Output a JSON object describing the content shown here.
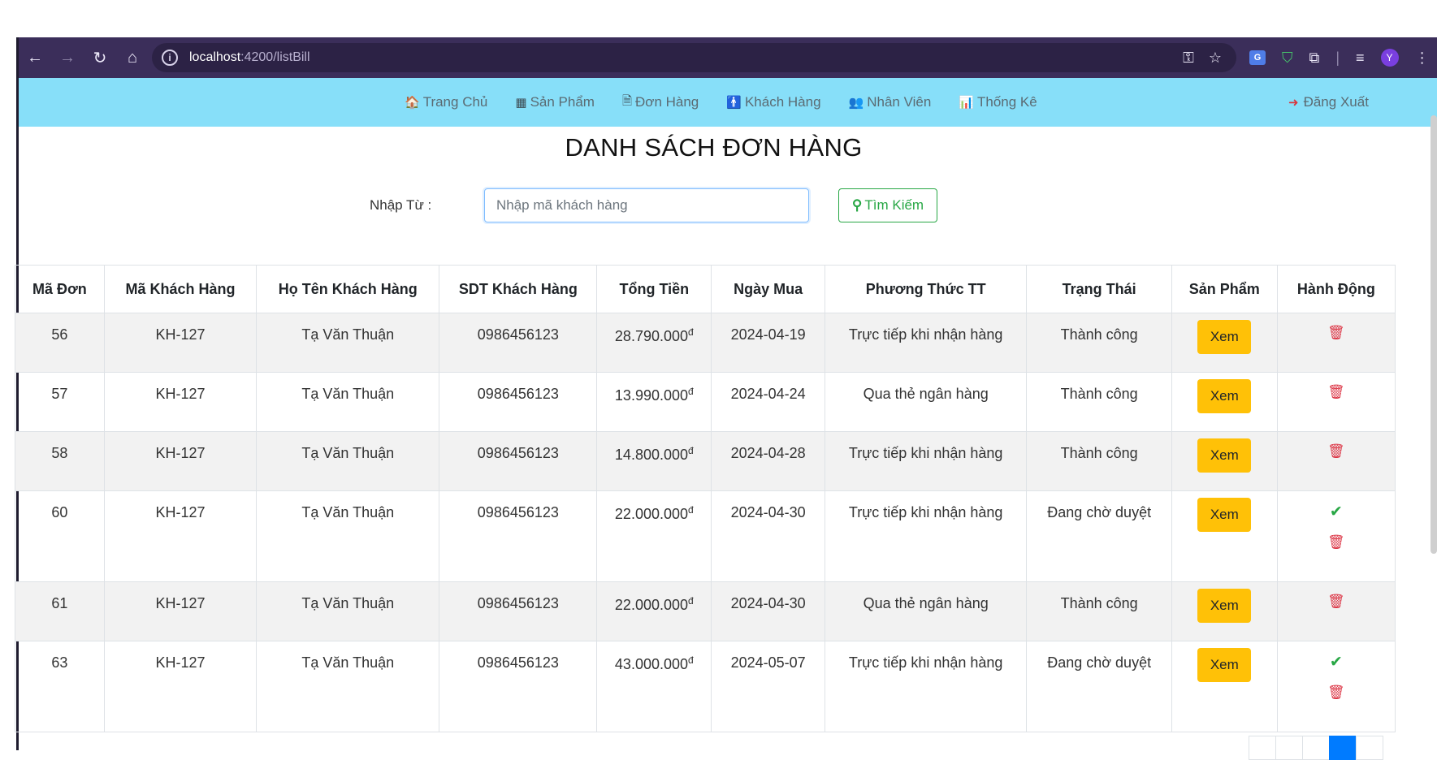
{
  "browser": {
    "url_host": "localhost",
    "url_path": ":4200/listBill",
    "icons": [
      "back-icon",
      "forward-icon",
      "reload-icon",
      "home-icon",
      "key-icon",
      "star-icon",
      "translate-icon",
      "shield-icon",
      "extensions-icon",
      "reading-list-icon",
      "profile-icon",
      "menu-icon"
    ],
    "profile_initial": "Y",
    "translate_label": "G"
  },
  "nav": {
    "links": [
      {
        "icon": "home-icon",
        "glyph": "🏠",
        "label": "Trang Chủ"
      },
      {
        "icon": "grid-icon",
        "glyph": "▦",
        "label": "Sản Phẩm"
      },
      {
        "icon": "file-icon",
        "glyph": "🗎",
        "label": "Đơn Hàng"
      },
      {
        "icon": "male-icon",
        "glyph": "🚹",
        "label": "Khách Hàng"
      },
      {
        "icon": "users-icon",
        "glyph": "👥",
        "label": "Nhân Viên"
      },
      {
        "icon": "bar-chart-icon",
        "glyph": "📊",
        "label": "Thống Kê"
      }
    ],
    "logout_label": "Đăng Xuất"
  },
  "page": {
    "title": "DANH SÁCH ĐƠN HÀNG",
    "search_label": "Nhập Từ :",
    "search_placeholder": "Nhập mã khách hàng",
    "search_button": "Tìm Kiếm"
  },
  "table": {
    "headers": [
      "Mã Đơn",
      "Mã Khách Hàng",
      "Họ Tên Khách Hàng",
      "SDT Khách Hàng",
      "Tổng Tiền",
      "Ngày Mua",
      "Phương Thức TT",
      "Trạng Thái",
      "Sản Phẩm",
      "Hành Động"
    ],
    "view_label": "Xem",
    "currency_symbol": "đ",
    "rows": [
      {
        "id": "56",
        "customer_code": "KH-127",
        "name": "Tạ Văn Thuận",
        "phone": "0986456123",
        "total": "28.790.000",
        "date": "2024-04-19",
        "payment": "Trực tiếp khi nhận hàng",
        "status": "Thành công",
        "status_type": "ok"
      },
      {
        "id": "57",
        "customer_code": "KH-127",
        "name": "Tạ Văn Thuận",
        "phone": "0986456123",
        "total": "13.990.000",
        "date": "2024-04-24",
        "payment": "Qua thẻ ngân hàng",
        "status": "Thành công",
        "status_type": "ok"
      },
      {
        "id": "58",
        "customer_code": "KH-127",
        "name": "Tạ Văn Thuận",
        "phone": "0986456123",
        "total": "14.800.000",
        "date": "2024-04-28",
        "payment": "Trực tiếp khi nhận hàng",
        "status": "Thành công",
        "status_type": "ok"
      },
      {
        "id": "60",
        "customer_code": "KH-127",
        "name": "Tạ Văn Thuận",
        "phone": "0986456123",
        "total": "22.000.000",
        "date": "2024-04-30",
        "payment": "Trực tiếp khi nhận hàng",
        "status": "Đang chờ duyệt",
        "status_type": "wait"
      },
      {
        "id": "61",
        "customer_code": "KH-127",
        "name": "Tạ Văn Thuận",
        "phone": "0986456123",
        "total": "22.000.000",
        "date": "2024-04-30",
        "payment": "Qua thẻ ngân hàng",
        "status": "Thành công",
        "status_type": "ok"
      },
      {
        "id": "63",
        "customer_code": "KH-127",
        "name": "Tạ Văn Thuận",
        "phone": "0986456123",
        "total": "43.000.000",
        "date": "2024-05-07",
        "payment": "Trực tiếp khi nhận hàng",
        "status": "Đang chờ duyệt",
        "status_type": "wait"
      }
    ]
  },
  "colors": {
    "navbar_bg": "#87dff9",
    "chrome_bg": "#3b2e5a",
    "money": "#dc3545",
    "success": "#28a745",
    "pending": "#ffd60a",
    "view_button": "#ffc107"
  }
}
